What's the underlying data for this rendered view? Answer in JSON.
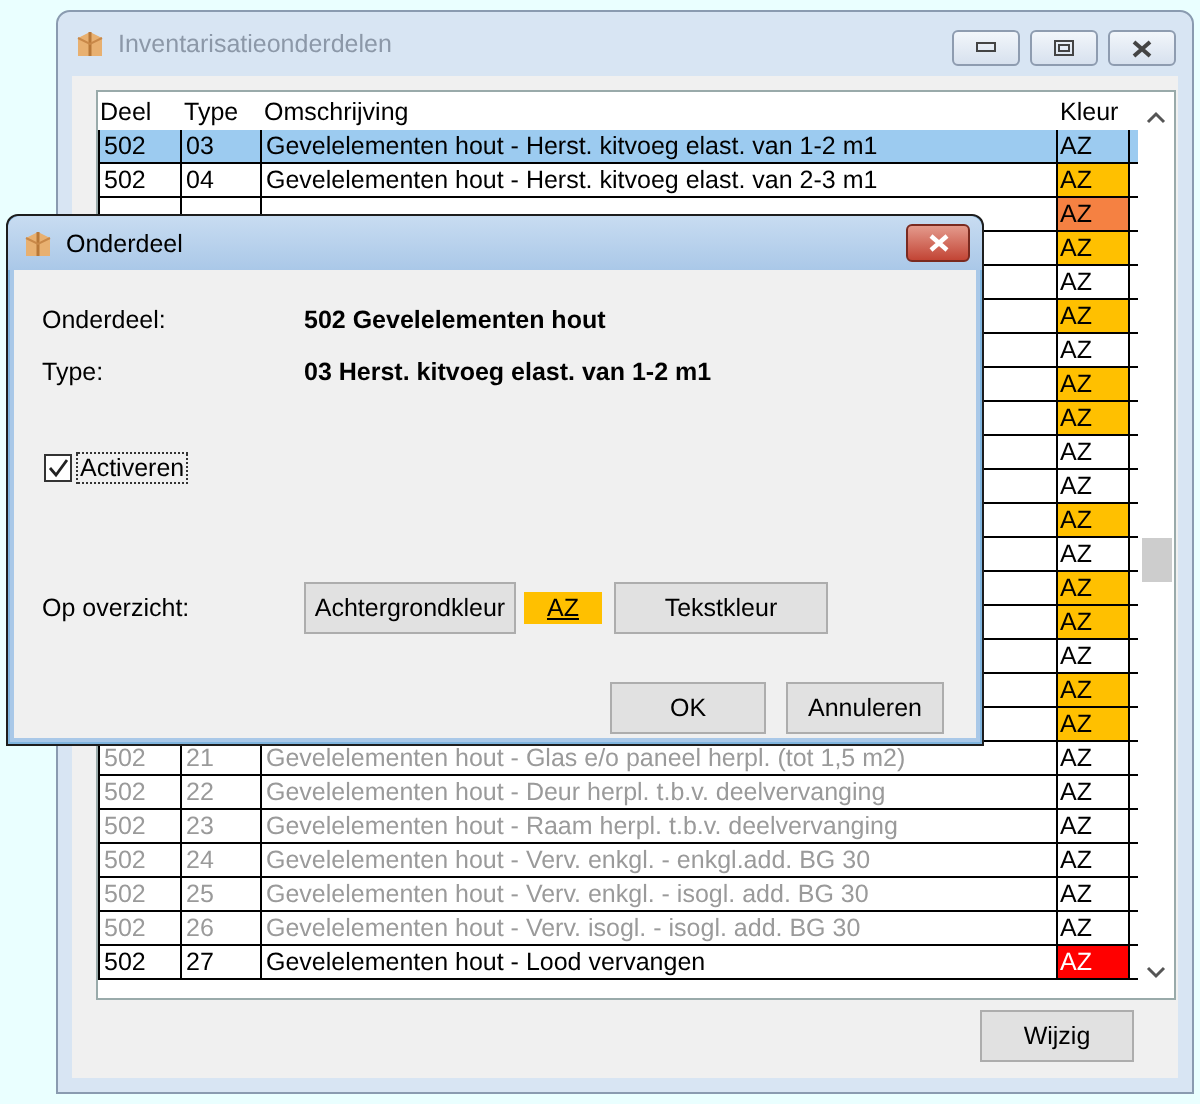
{
  "window": {
    "title": "Inventarisatieonderdelen"
  },
  "table": {
    "columns": [
      "Deel",
      "Type",
      "Omschrijving",
      "Kleur"
    ],
    "rows": [
      {
        "deel": "502",
        "type": "03",
        "description": "Gevelelementen hout - Herst. kitvoeg elast. van 1-2 m1",
        "kleur": {
          "text": "AZ"
        },
        "selected": true,
        "disabled": false
      },
      {
        "deel": "502",
        "type": "04",
        "description": "Gevelelementen hout - Herst. kitvoeg elast. van 2-3 m1",
        "kleur": {
          "text": "AZ",
          "color": "#ffc000"
        },
        "selected": false,
        "disabled": false
      },
      {
        "kleur": {
          "text": "AZ",
          "color": "#f58142"
        },
        "selected": false
      },
      {
        "kleur": {
          "text": "AZ",
          "color": "#ffc000"
        },
        "selected": false
      },
      {
        "kleur": {
          "text": "AZ",
          "color": "#ffffff"
        },
        "selected": false
      },
      {
        "kleur": {
          "text": "AZ",
          "color": "#ffc000"
        },
        "selected": false
      },
      {
        "kleur": {
          "text": "AZ",
          "color": "#ffffff"
        },
        "selected": false
      },
      {
        "kleur": {
          "text": "AZ",
          "color": "#ffc000"
        },
        "selected": false
      },
      {
        "kleur": {
          "text": "AZ",
          "color": "#ffc000"
        },
        "selected": false
      },
      {
        "kleur": {
          "text": "AZ",
          "color": "#ffffff"
        },
        "selected": false
      },
      {
        "kleur": {
          "text": "AZ",
          "color": "#ffffff"
        },
        "selected": false
      },
      {
        "kleur": {
          "text": "AZ",
          "color": "#ffc000"
        },
        "selected": false
      },
      {
        "kleur": {
          "text": "AZ",
          "color": "#ffffff"
        },
        "selected": false
      },
      {
        "kleur": {
          "text": "AZ",
          "color": "#ffc000"
        },
        "selected": false
      },
      {
        "kleur": {
          "text": "AZ",
          "color": "#ffc000"
        },
        "selected": false
      },
      {
        "kleur": {
          "text": "AZ",
          "color": "#ffffff"
        },
        "selected": false
      },
      {
        "kleur": {
          "text": "AZ",
          "color": "#ffc000"
        },
        "selected": false
      },
      {
        "kleur": {
          "text": "AZ",
          "color": "#ffc000"
        },
        "selected": false
      },
      {
        "deel": "502",
        "type": "21",
        "description": "Gevelelementen hout - Glas e/o paneel herpl. (tot 1,5 m2)",
        "kleur": {
          "text": "AZ",
          "color": "#ffffff"
        },
        "selected": false,
        "disabled": true
      },
      {
        "deel": "502",
        "type": "22",
        "description": "Gevelelementen hout - Deur herpl. t.b.v. deelvervanging",
        "kleur": {
          "text": "AZ",
          "color": "#ffffff"
        },
        "selected": false,
        "disabled": true
      },
      {
        "deel": "502",
        "type": "23",
        "description": "Gevelelementen hout - Raam herpl. t.b.v. deelvervanging",
        "kleur": {
          "text": "AZ",
          "color": "#ffffff"
        },
        "selected": false,
        "disabled": true
      },
      {
        "deel": "502",
        "type": "24",
        "description": "Gevelelementen hout - Verv. enkgl. - enkgl.add. BG 30",
        "kleur": {
          "text": "AZ",
          "color": "#ffffff"
        },
        "selected": false,
        "disabled": true
      },
      {
        "deel": "502",
        "type": "25",
        "description": "Gevelelementen hout - Verv. enkgl. - isogl. add. BG 30",
        "kleur": {
          "text": "AZ",
          "color": "#ffffff"
        },
        "selected": false,
        "disabled": true
      },
      {
        "deel": "502",
        "type": "26",
        "description": "Gevelelementen hout - Verv. isogl. - isogl. add. BG 30",
        "kleur": {
          "text": "AZ",
          "color": "#ffffff"
        },
        "selected": false,
        "disabled": true
      },
      {
        "deel": "502",
        "type": "27",
        "description": "Gevelelementen hout - Lood vervangen",
        "kleur": {
          "text": "AZ",
          "color": "#ff0000"
        },
        "selected": false,
        "disabled": false
      }
    ]
  },
  "buttons": [
    "Wijzig"
  ],
  "dialog": {
    "title": "Onderdeel",
    "fields": [
      {
        "label": "Onderdeel:",
        "value": "502 Gevelelementen hout"
      },
      {
        "label": "Type:",
        "value": "03 Herst. kitvoeg elast. van 1-2 m1"
      }
    ],
    "checkbox": {
      "label": "Activeren",
      "checked": true
    },
    "overview": {
      "label": "Op overzicht:",
      "background_button": "Achtergrondkleur",
      "sample": {
        "text": "AZ",
        "color": "#ffc000"
      },
      "text_button": "Tekstkleur"
    },
    "buttons": [
      "OK",
      "Annuleren"
    ]
  }
}
